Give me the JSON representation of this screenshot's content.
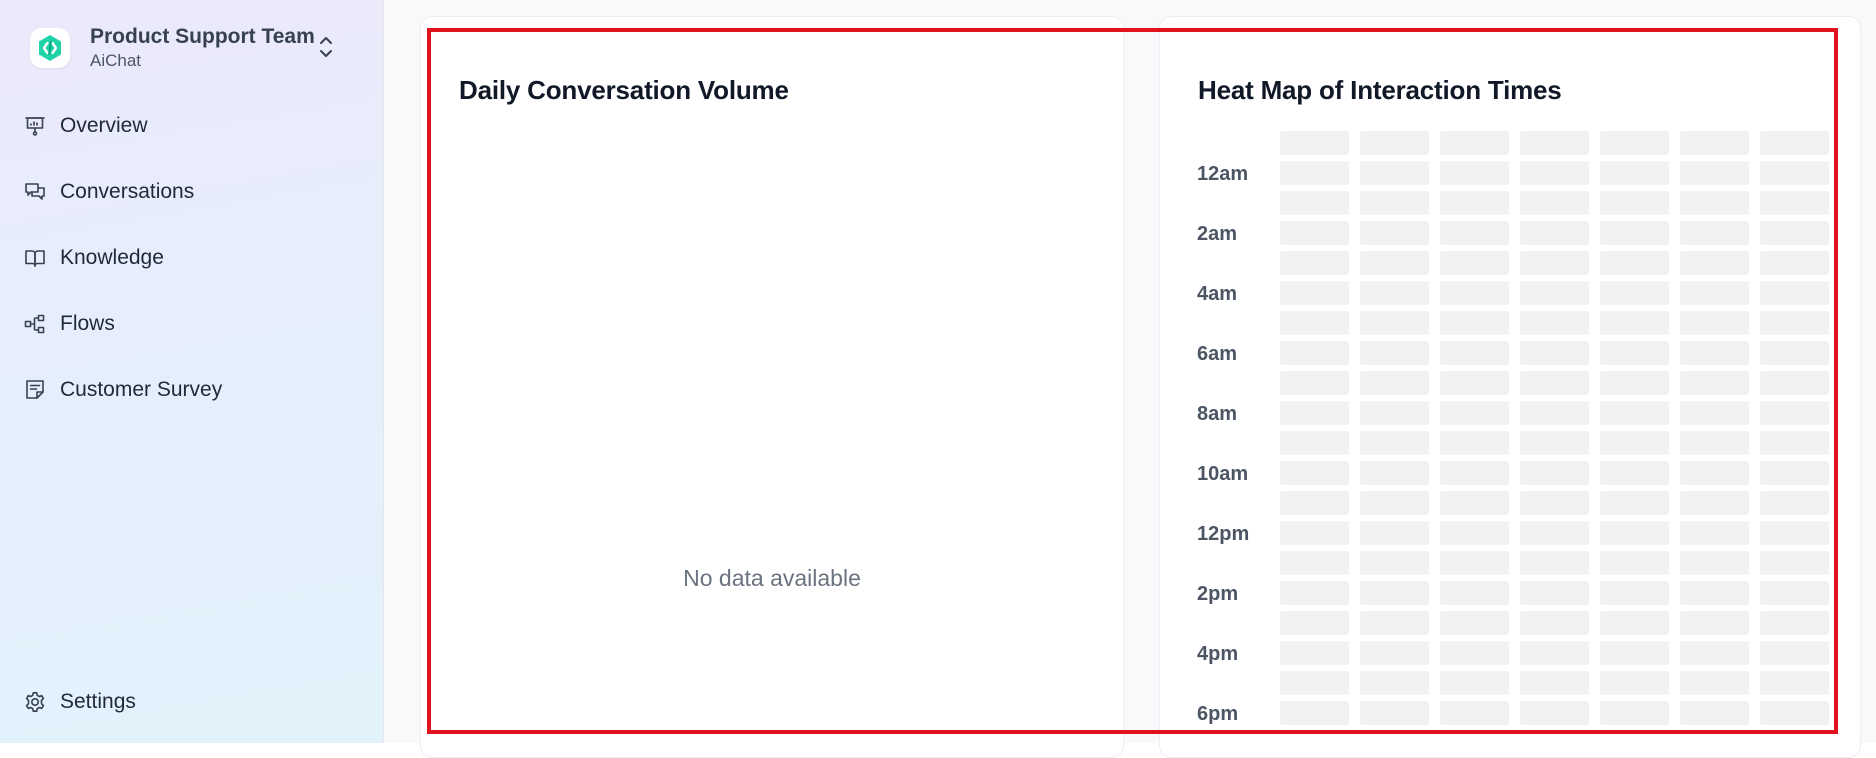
{
  "sidebar": {
    "team_name": "Product Support Team",
    "team_sub": "AiChat",
    "items": [
      {
        "label": "Overview",
        "icon": "presentation-icon"
      },
      {
        "label": "Conversations",
        "icon": "chat-bubbles-icon"
      },
      {
        "label": "Knowledge",
        "icon": "book-open-icon"
      },
      {
        "label": "Flows",
        "icon": "flow-icon"
      },
      {
        "label": "Customer Survey",
        "icon": "survey-icon"
      }
    ],
    "settings_label": "Settings"
  },
  "cards": {
    "daily": {
      "title": "Daily Conversation Volume",
      "empty_message": "No data available"
    },
    "heatmap": {
      "title": "Heat Map of Interaction Times",
      "row_labels": [
        "12am",
        "2am",
        "4am",
        "6am",
        "8am",
        "10am",
        "12pm",
        "2pm",
        "4pm",
        "6pm"
      ]
    }
  },
  "colors": {
    "brand_teal": "#1ed3a8",
    "highlight": "#e0141e",
    "heatmap_empty": "#f2f2f3"
  }
}
